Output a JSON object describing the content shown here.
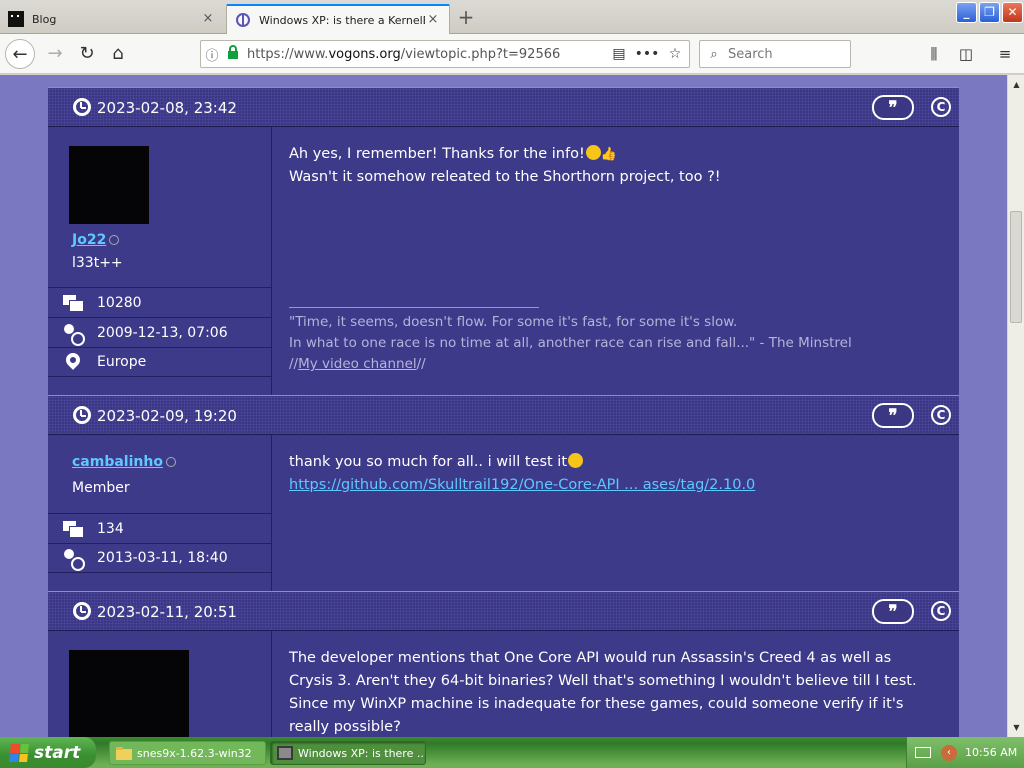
{
  "browser": {
    "tabs": [
      {
        "title": "Blog",
        "active": false
      },
      {
        "title": "Windows XP: is there a KernelEX?",
        "active": true
      }
    ],
    "url_prefix": "https://www.",
    "url_domain": "vogons.org",
    "url_path": "/viewtopic.php?t=92566",
    "search_placeholder": "Search",
    "new_tab_label": "+",
    "close_glyph": "×"
  },
  "posts": [
    {
      "date": "2023-02-08, 23:42",
      "username": "Jo22",
      "rank": "l33t++",
      "stats": {
        "posts": "10280",
        "joined": "2009-12-13, 07:06",
        "location": "Europe"
      },
      "content_line1": "Ah yes, I remember! Thanks for the info!",
      "content_line2": "Wasn't it somehow releated to the Shorthorn project, too ?!",
      "signature_line1": "\"Time, it seems, doesn't flow. For some it's fast, for some it's slow.",
      "signature_line2": "In what to one race is no time at all, another race can rise and fall...\" - The Minstrel",
      "signature_prefix": "//",
      "signature_link": "My video channel",
      "signature_suffix": "//"
    },
    {
      "date": "2023-02-09, 19:20",
      "username": "cambalinho",
      "rank": "Member",
      "stats": {
        "posts": "134",
        "joined": "2013-03-11, 18:40"
      },
      "content_line1": "thank you so much for all.. i will test it",
      "link": "https://github.com/Skulltrail192/One-Core-API ... ases/tag/2.10.0"
    },
    {
      "date": "2023-02-11, 20:51",
      "content": "The developer mentions that One Core API would run Assassin's Creed 4 as well as Crysis 3. Aren't they 64-bit binaries? Well that's something I wouldn't believe till I test. Since my WinXP machine is inadequate for these games, could someone verify if it's really possible?"
    }
  ],
  "post_buttons": {
    "quote": "❞",
    "copy": "C"
  },
  "taskbar": {
    "start_label": "start",
    "tasks": [
      {
        "label": "snes9x-1.62.3-win32"
      },
      {
        "label": "Windows XP: is there ..."
      }
    ],
    "clock": "10:56 AM"
  },
  "colors": {
    "page_bg": "#7a78c0",
    "post_bg": "#3d3a8a",
    "username": "#5ec8ff",
    "accent_tab": "#0a84ff"
  }
}
